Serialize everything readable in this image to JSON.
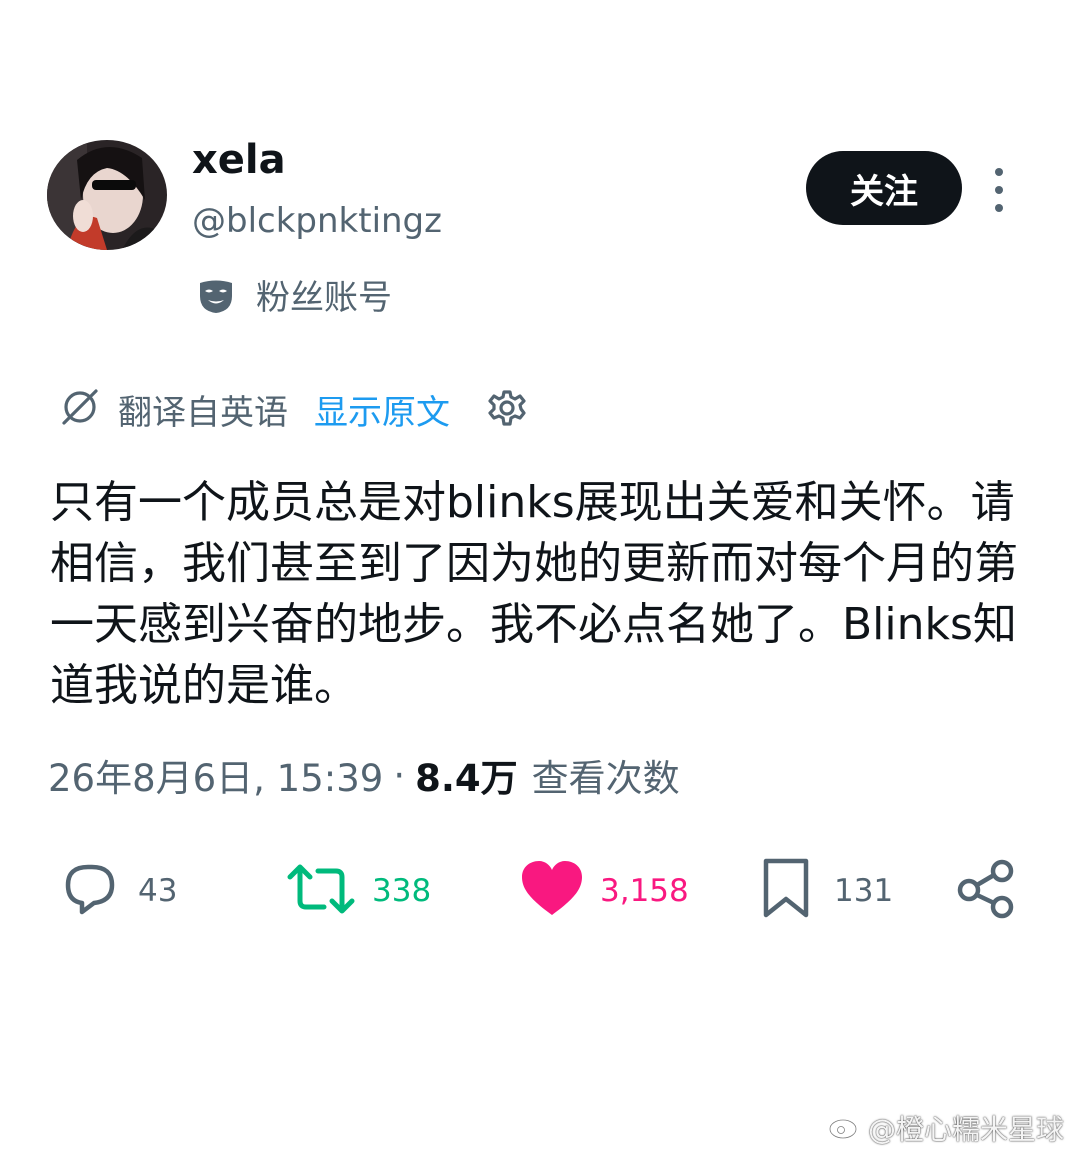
{
  "user": {
    "display_name": "xela",
    "handle": "@blckpnktingz",
    "badge_label": "粉丝账号"
  },
  "follow_button_label": "关注",
  "translation": {
    "label": "翻译自英语",
    "show_original": "显示原文"
  },
  "tweet": {
    "text": "只有一个成员总是对blinks展现出关爱和关怀。请相信，我们甚至到了因为她的更新而对每个月的第一天感到兴奋的地步。我不必点名她了。Blinks知道我说的是谁。"
  },
  "meta": {
    "timestamp": "26年8月6日, 15:39",
    "separator": "·",
    "views_count": "8.4万",
    "views_label": "查看次数"
  },
  "actions": {
    "replies": "43",
    "retweets": "338",
    "likes": "3,158",
    "bookmarks": "131"
  },
  "colors": {
    "text": "#0f1419",
    "secondary": "#536471",
    "link": "#1d9bf0",
    "retweet": "#00ba7c",
    "like": "#f91880"
  },
  "watermark": "@橙心糯米星球"
}
